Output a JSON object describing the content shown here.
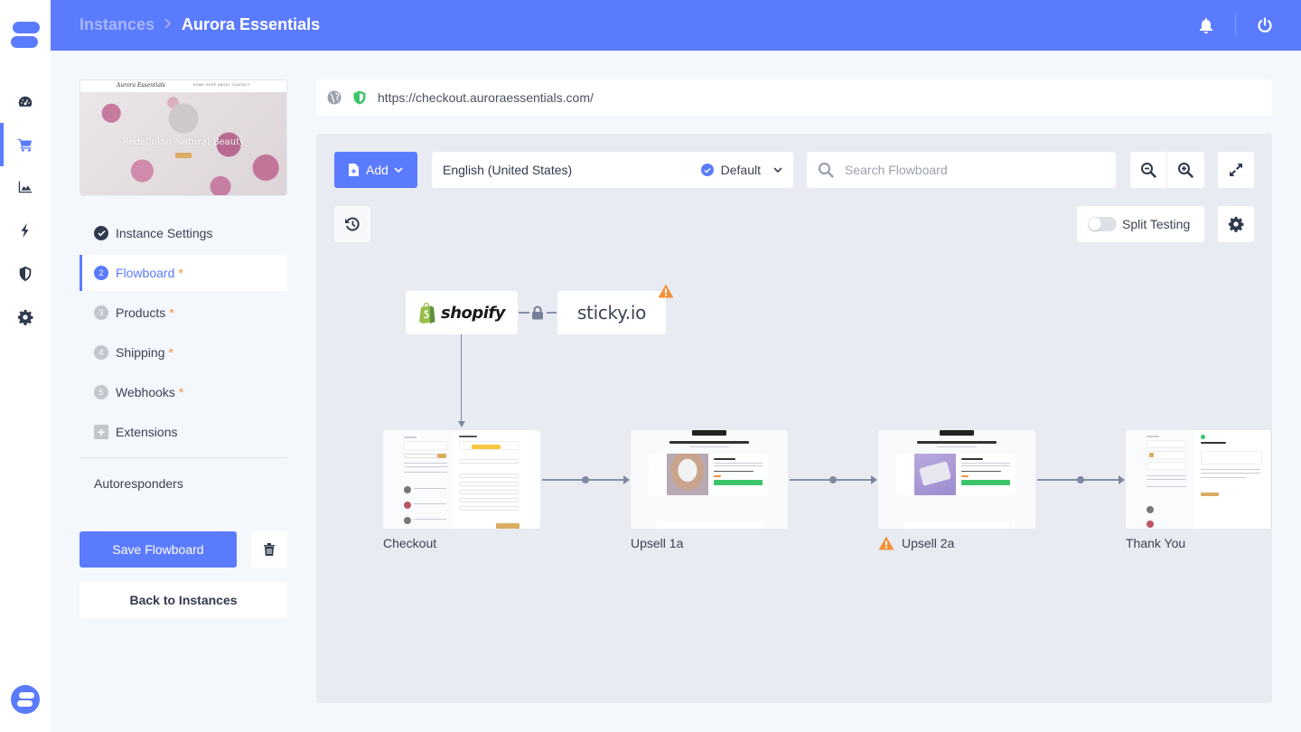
{
  "header": {
    "breadcrumb": [
      "Instances",
      "Aurora Essentials"
    ],
    "breadcrumb_separator": ">",
    "icons": [
      "bell-icon",
      "power-icon"
    ]
  },
  "rail": {
    "items": [
      {
        "name": "dashboard",
        "icon": "speedometer-icon",
        "active": false
      },
      {
        "name": "store",
        "icon": "cart-icon",
        "active": true
      },
      {
        "name": "analytics",
        "icon": "area-chart-icon",
        "active": false
      },
      {
        "name": "automation",
        "icon": "bolt-icon",
        "active": false
      },
      {
        "name": "security",
        "icon": "shield-icon",
        "active": false
      },
      {
        "name": "settings",
        "icon": "gear-icon",
        "active": false
      }
    ],
    "accent": "#5b7bfe"
  },
  "preview": {
    "brand": "Aurora Essentials",
    "nav": "HOME  SHOP  ABOUT  CONTACT",
    "headline": "Redefining Natural Beauty"
  },
  "steps": [
    {
      "num": "✓",
      "label": "Instance Settings",
      "required": false,
      "state": "done"
    },
    {
      "num": "2",
      "label": "Flowboard",
      "required": true,
      "state": "active"
    },
    {
      "num": "3",
      "label": "Products",
      "required": true,
      "state": "pending"
    },
    {
      "num": "4",
      "label": "Shipping",
      "required": true,
      "state": "pending"
    },
    {
      "num": "5",
      "label": "Webhooks",
      "required": true,
      "state": "pending"
    },
    {
      "num": "+",
      "label": "Extensions",
      "required": false,
      "state": "extension"
    }
  ],
  "required_marker": "*",
  "autoresponders_label": "Autoresponders",
  "actions": {
    "save_label": "Save Flowboard",
    "back_label": "Back to Instances"
  },
  "url_bar": {
    "url": "https://checkout.auroraessentials.com/"
  },
  "toolbar": {
    "add_label": "Add",
    "language": "English (United States)",
    "language_badge": "Default",
    "search_placeholder": "Search Flowboard",
    "search_value": "",
    "split_testing_label": "Split Testing",
    "split_testing_on": false
  },
  "integrations": {
    "platform": "shopify",
    "crm": "sticky.io",
    "crm_warning": true
  },
  "flow": {
    "pages": [
      {
        "label": "Checkout",
        "warning": false
      },
      {
        "label": "Upsell 1a",
        "warning": false
      },
      {
        "label": "Upsell 2a",
        "warning": true
      },
      {
        "label": "Thank You",
        "warning": false
      }
    ]
  },
  "thumbnails": {
    "upsell_banner": "UPGRADE YOUR GIFT & SAVE",
    "upsell_headline": "Hey! We have a something special for you...",
    "upsell1_product": "FACIAL MASK",
    "upsell2_product": "FACIAL WIPES",
    "thankyou_title": "Thank you for your purchase!",
    "checkout_brand": "Aurora Essentials"
  },
  "colors": {
    "accent": "#5b7bfe",
    "warning": "#f0913a",
    "success": "#3cc46b"
  }
}
